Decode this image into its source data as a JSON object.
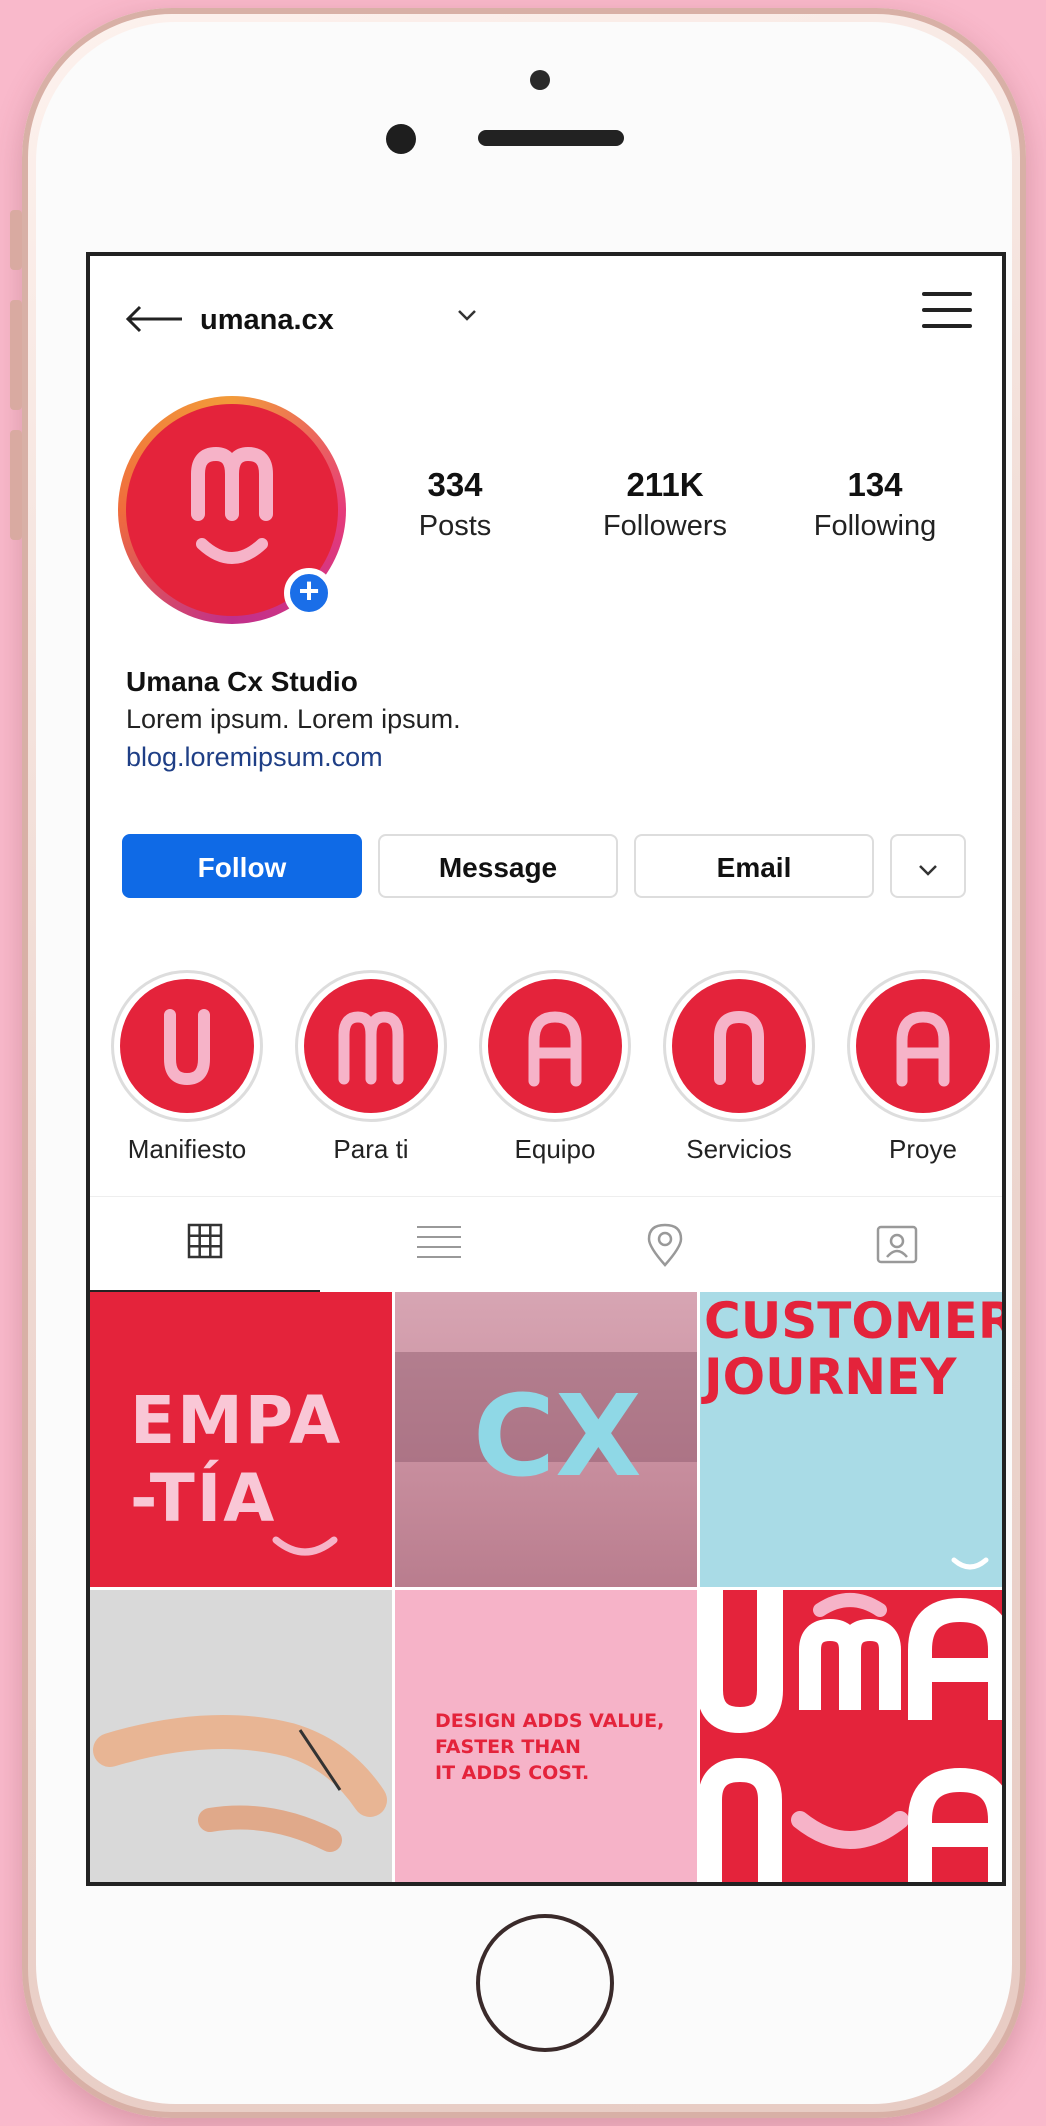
{
  "header": {
    "username": "umana.cx"
  },
  "stats": {
    "posts": {
      "value": "334",
      "label": "Posts"
    },
    "followers": {
      "value": "211K",
      "label": "Followers"
    },
    "following": {
      "value": "134",
      "label": "Following"
    }
  },
  "bio": {
    "name": "Umana Cx Studio",
    "text": "Lorem ipsum. Lorem ipsum.",
    "link": "blog.loremipsum.com"
  },
  "actions": {
    "follow": "Follow",
    "message": "Message",
    "email": "Email"
  },
  "highlights": [
    {
      "letter": "U",
      "label": "Manifiesto"
    },
    {
      "letter": "m",
      "label": "Para ti"
    },
    {
      "letter": "A",
      "label": "Equipo"
    },
    {
      "letter": "n",
      "label": "Servicios"
    },
    {
      "letter": "A",
      "label": "Proye"
    }
  ],
  "grid_posts": {
    "p1": {
      "line1": "EMPA",
      "line2": "-TÍA"
    },
    "p2": {
      "title": "CX"
    },
    "p3": {
      "line1": "CUSTOMER",
      "line2": "JOURNEY"
    },
    "p5": {
      "line1": "DESIGN ADDS VALUE,",
      "line2": "FASTER THAN",
      "line3": "IT ADDS COST."
    }
  },
  "colors": {
    "brand_red": "#e4233b",
    "follow_blue": "#0f6ae6",
    "background_pink": "#f9b9cb"
  }
}
